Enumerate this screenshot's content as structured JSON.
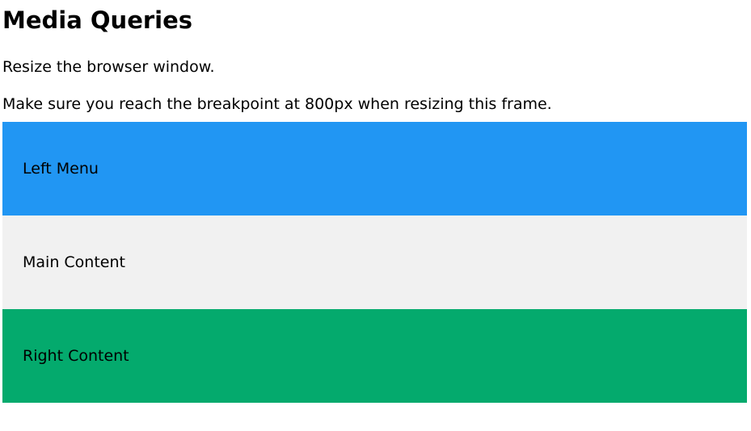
{
  "heading": "Media Queries",
  "paragraphs": {
    "first": "Resize the browser window.",
    "second": "Make sure you reach the breakpoint at 800px when resizing this frame."
  },
  "columns": {
    "left": {
      "label": "Left Menu",
      "color": "#2196F3"
    },
    "main": {
      "label": "Main Content",
      "color": "#f1f1f1"
    },
    "right": {
      "label": "Right Content",
      "color": "#04AA6D"
    }
  }
}
